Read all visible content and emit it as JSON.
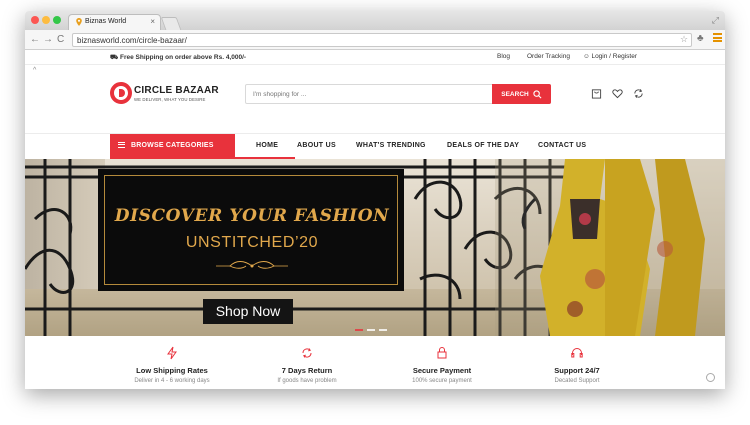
{
  "browser": {
    "tab_title": "Biznas World",
    "url": "biznasworld.com/circle-bazaar/"
  },
  "topbar": {
    "free_shipping": "Free Shipping on order above Rs. 4,000/-",
    "links": [
      "Blog",
      "Order Tracking",
      "Login / Register"
    ]
  },
  "header": {
    "logo_name": "CIRCLE BAZAAR",
    "logo_tagline": "WE DELIVER, WHAT YOU DESIRE",
    "search_placeholder": "I'm shopping for ...",
    "search_button": "SEARCH"
  },
  "nav": {
    "browse": "BROWSE CATEGORIES",
    "items": [
      "HOME",
      "ABOUT US",
      "WHAT'S TRENDING",
      "DEALS OF THE DAY",
      "CONTACT US"
    ]
  },
  "hero": {
    "line1": "DISCOVER YOUR FASHION",
    "line2": "UNSTITCHED’20",
    "cta": "Shop Now"
  },
  "features": [
    {
      "title": "Low Shipping Rates",
      "sub": "Deliver in 4 - 6 working days"
    },
    {
      "title": "7 Days Return",
      "sub": "If goods have problem"
    },
    {
      "title": "Secure Payment",
      "sub": "100% secure payment"
    },
    {
      "title": "Support 24/7",
      "sub": "Decated Support"
    }
  ],
  "colors": {
    "accent": "#e8323c",
    "gold": "#e1a84c"
  }
}
